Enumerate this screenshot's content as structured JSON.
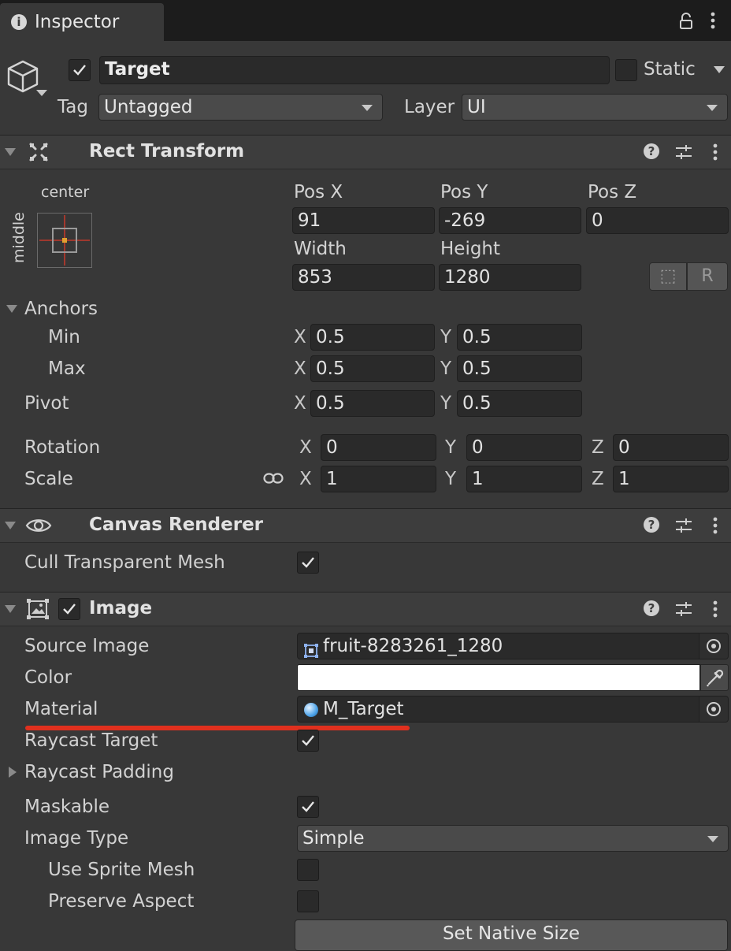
{
  "tab": {
    "title": "Inspector",
    "info_icon": "info-icon",
    "lock_icon": "lock-icon",
    "menu_icon": "kebab-menu-icon"
  },
  "object": {
    "name": "Target",
    "active": true,
    "static_label": "Static",
    "static_checked": false,
    "tag_label": "Tag",
    "tag_value": "Untagged",
    "layer_label": "Layer",
    "layer_value": "UI"
  },
  "rect_transform": {
    "title": "Rect Transform",
    "anchor_preset_top": "center",
    "anchor_preset_side": "middle",
    "pos_x_label": "Pos X",
    "pos_y_label": "Pos Y",
    "pos_z_label": "Pos Z",
    "pos_x": "91",
    "pos_y": "-269",
    "pos_z": "0",
    "width_label": "Width",
    "height_label": "Height",
    "width": "853",
    "height": "1280",
    "blueprint_btn": "⬚",
    "raw_btn": "R",
    "anchors_label": "Anchors",
    "min_label": "Min",
    "max_label": "Max",
    "pivot_label": "Pivot",
    "x_axis": "X",
    "y_axis": "Y",
    "z_axis": "Z",
    "min_x": "0.5",
    "min_y": "0.5",
    "max_x": "0.5",
    "max_y": "0.5",
    "pivot_x": "0.5",
    "pivot_y": "0.5",
    "rotation_label": "Rotation",
    "rot_x": "0",
    "rot_y": "0",
    "rot_z": "0",
    "scale_label": "Scale",
    "scale_x": "1",
    "scale_y": "1",
    "scale_z": "1"
  },
  "canvas_renderer": {
    "title": "Canvas Renderer",
    "cull_label": "Cull Transparent Mesh",
    "cull_checked": true
  },
  "image": {
    "title": "Image",
    "enabled": true,
    "source_label": "Source Image",
    "source_value": "fruit-8283261_1280",
    "color_label": "Color",
    "color_value": "#ffffff",
    "material_label": "Material",
    "material_value": "M_Target",
    "raycast_target_label": "Raycast Target",
    "raycast_target_checked": true,
    "raycast_padding_label": "Raycast Padding",
    "maskable_label": "Maskable",
    "maskable_checked": true,
    "image_type_label": "Image Type",
    "image_type_value": "Simple",
    "use_sprite_mesh_label": "Use Sprite Mesh",
    "use_sprite_mesh_checked": false,
    "preserve_aspect_label": "Preserve Aspect",
    "preserve_aspect_checked": false,
    "set_native_size_label": "Set Native Size"
  },
  "annotation": {
    "underline_color": "#e0301e"
  },
  "colors": {
    "background": "#383838",
    "field": "#2a2a2a",
    "header": "#3d3d3d",
    "tabbar": "#1c1c1c",
    "accent_check": "#e6e6e6"
  }
}
